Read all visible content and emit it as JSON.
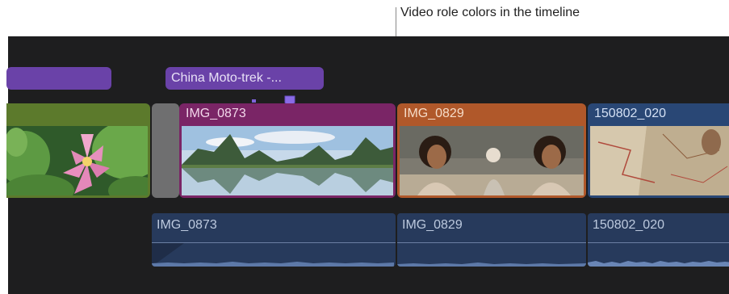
{
  "callout": {
    "label": "Video role colors in the timeline"
  },
  "titles": [
    {
      "label": ""
    },
    {
      "label": "China Moto-trek -..."
    }
  ],
  "video_clips": [
    {
      "name": "IMG_0873",
      "role_color": "#7a2566"
    },
    {
      "name": "IMG_0829",
      "role_color": "#b0582a"
    },
    {
      "name": "150802_020",
      "role_color": "#294775"
    }
  ],
  "audio_clips": [
    {
      "name": "IMG_0873"
    },
    {
      "name": "IMG_0829"
    },
    {
      "name": "150802_020"
    }
  ],
  "colors": {
    "title_role": "#6a42a8",
    "lotus_clip_role": "#5c7a2c",
    "timeline_background": "#1e1e1f",
    "audio_role": "#273a5c"
  }
}
